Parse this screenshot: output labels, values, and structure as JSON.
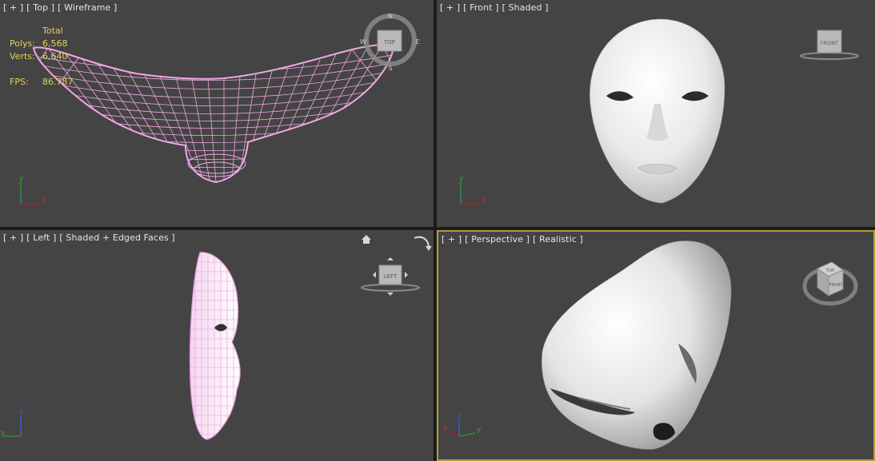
{
  "viewports": {
    "top": {
      "plus": "[ + ]",
      "view": "[ Top ]",
      "mode": "[ Wireframe ]",
      "cube_label": "TOP"
    },
    "front": {
      "plus": "[ + ]",
      "view": "[ Front ]",
      "mode": "[ Shaded ]",
      "cube_label": "FRONT"
    },
    "left": {
      "plus": "[ + ]",
      "view": "[ Left ]",
      "mode": "[ Shaded + Edged Faces ]",
      "cube_label": "LEFT"
    },
    "persp": {
      "plus": "[ + ]",
      "view": "[ Perspective ]",
      "mode": "[ Realistic ]",
      "cube_top": "TOP",
      "cube_front": "FRONT"
    }
  },
  "stats": {
    "header": "Total",
    "polys_label": "Polys:",
    "polys_value": "6,568",
    "verts_label": "Verts:",
    "verts_value": "6,640",
    "fps_label": "FPS:",
    "fps_value": "86.787"
  },
  "axes": {
    "x": "x",
    "y": "y",
    "z": "z"
  },
  "compass": {
    "north": "N",
    "south": "S",
    "east": "E",
    "west": "W"
  },
  "colors": {
    "viewport_bg": "#444444",
    "wireframe": "#f2a6e6",
    "stats_text": "#e8d05a",
    "active_border": "#b69b3a"
  },
  "icons": {
    "home": "home-icon",
    "rotate": "rotate-arrow-icon"
  }
}
